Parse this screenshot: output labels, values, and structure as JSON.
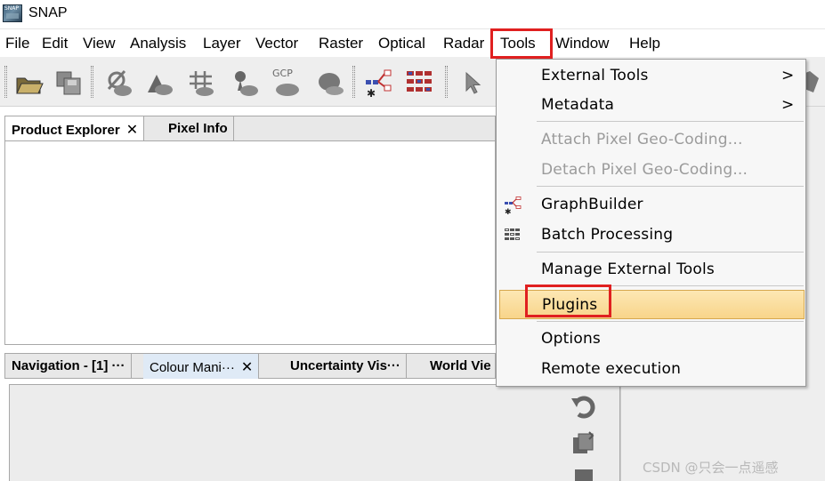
{
  "window": {
    "title": "SNAP",
    "logo_text": "SNAP"
  },
  "menubar": {
    "items": [
      "File",
      "Edit",
      "View",
      "Analysis",
      "Layer",
      "Vector",
      "Raster",
      "Optical",
      "Radar",
      "Tools",
      "Window",
      "Help"
    ],
    "highlighted": "Tools"
  },
  "product_panel": {
    "tabs": [
      {
        "label": "Product Explorer",
        "close": "✕"
      },
      {
        "label": "Pixel Info"
      }
    ]
  },
  "bottom_panel": {
    "tabs": [
      {
        "label": "Navigation - [1] ···"
      },
      {
        "label": "Colour Mani···",
        "close": "✕"
      },
      {
        "label": "Uncertainty Vis···"
      },
      {
        "label": "World Vie"
      }
    ]
  },
  "tools_menu": {
    "items": [
      {
        "label": "External Tools",
        "submenu": true,
        "arrow": ">"
      },
      {
        "label": "Metadata",
        "submenu": true,
        "arrow": ">"
      },
      {
        "label": "Attach Pixel Geo-Coding...",
        "disabled": true
      },
      {
        "label": "Detach Pixel Geo-Coding...",
        "disabled": true
      },
      {
        "label": "GraphBuilder",
        "icon": "graph-builder-icon"
      },
      {
        "label": "Batch Processing",
        "icon": "batch-processing-icon"
      },
      {
        "label": "Manage External Tools"
      },
      {
        "label": "Plugins",
        "highlighted": true
      },
      {
        "label": "Options"
      },
      {
        "label": "Remote execution"
      }
    ]
  },
  "toolbar": {
    "gcp_label": "GCP"
  },
  "watermark": "CSDN @只会一点遥感",
  "colors": {
    "highlight_box": "#e02020",
    "menu_hover": "#f8d48a"
  }
}
